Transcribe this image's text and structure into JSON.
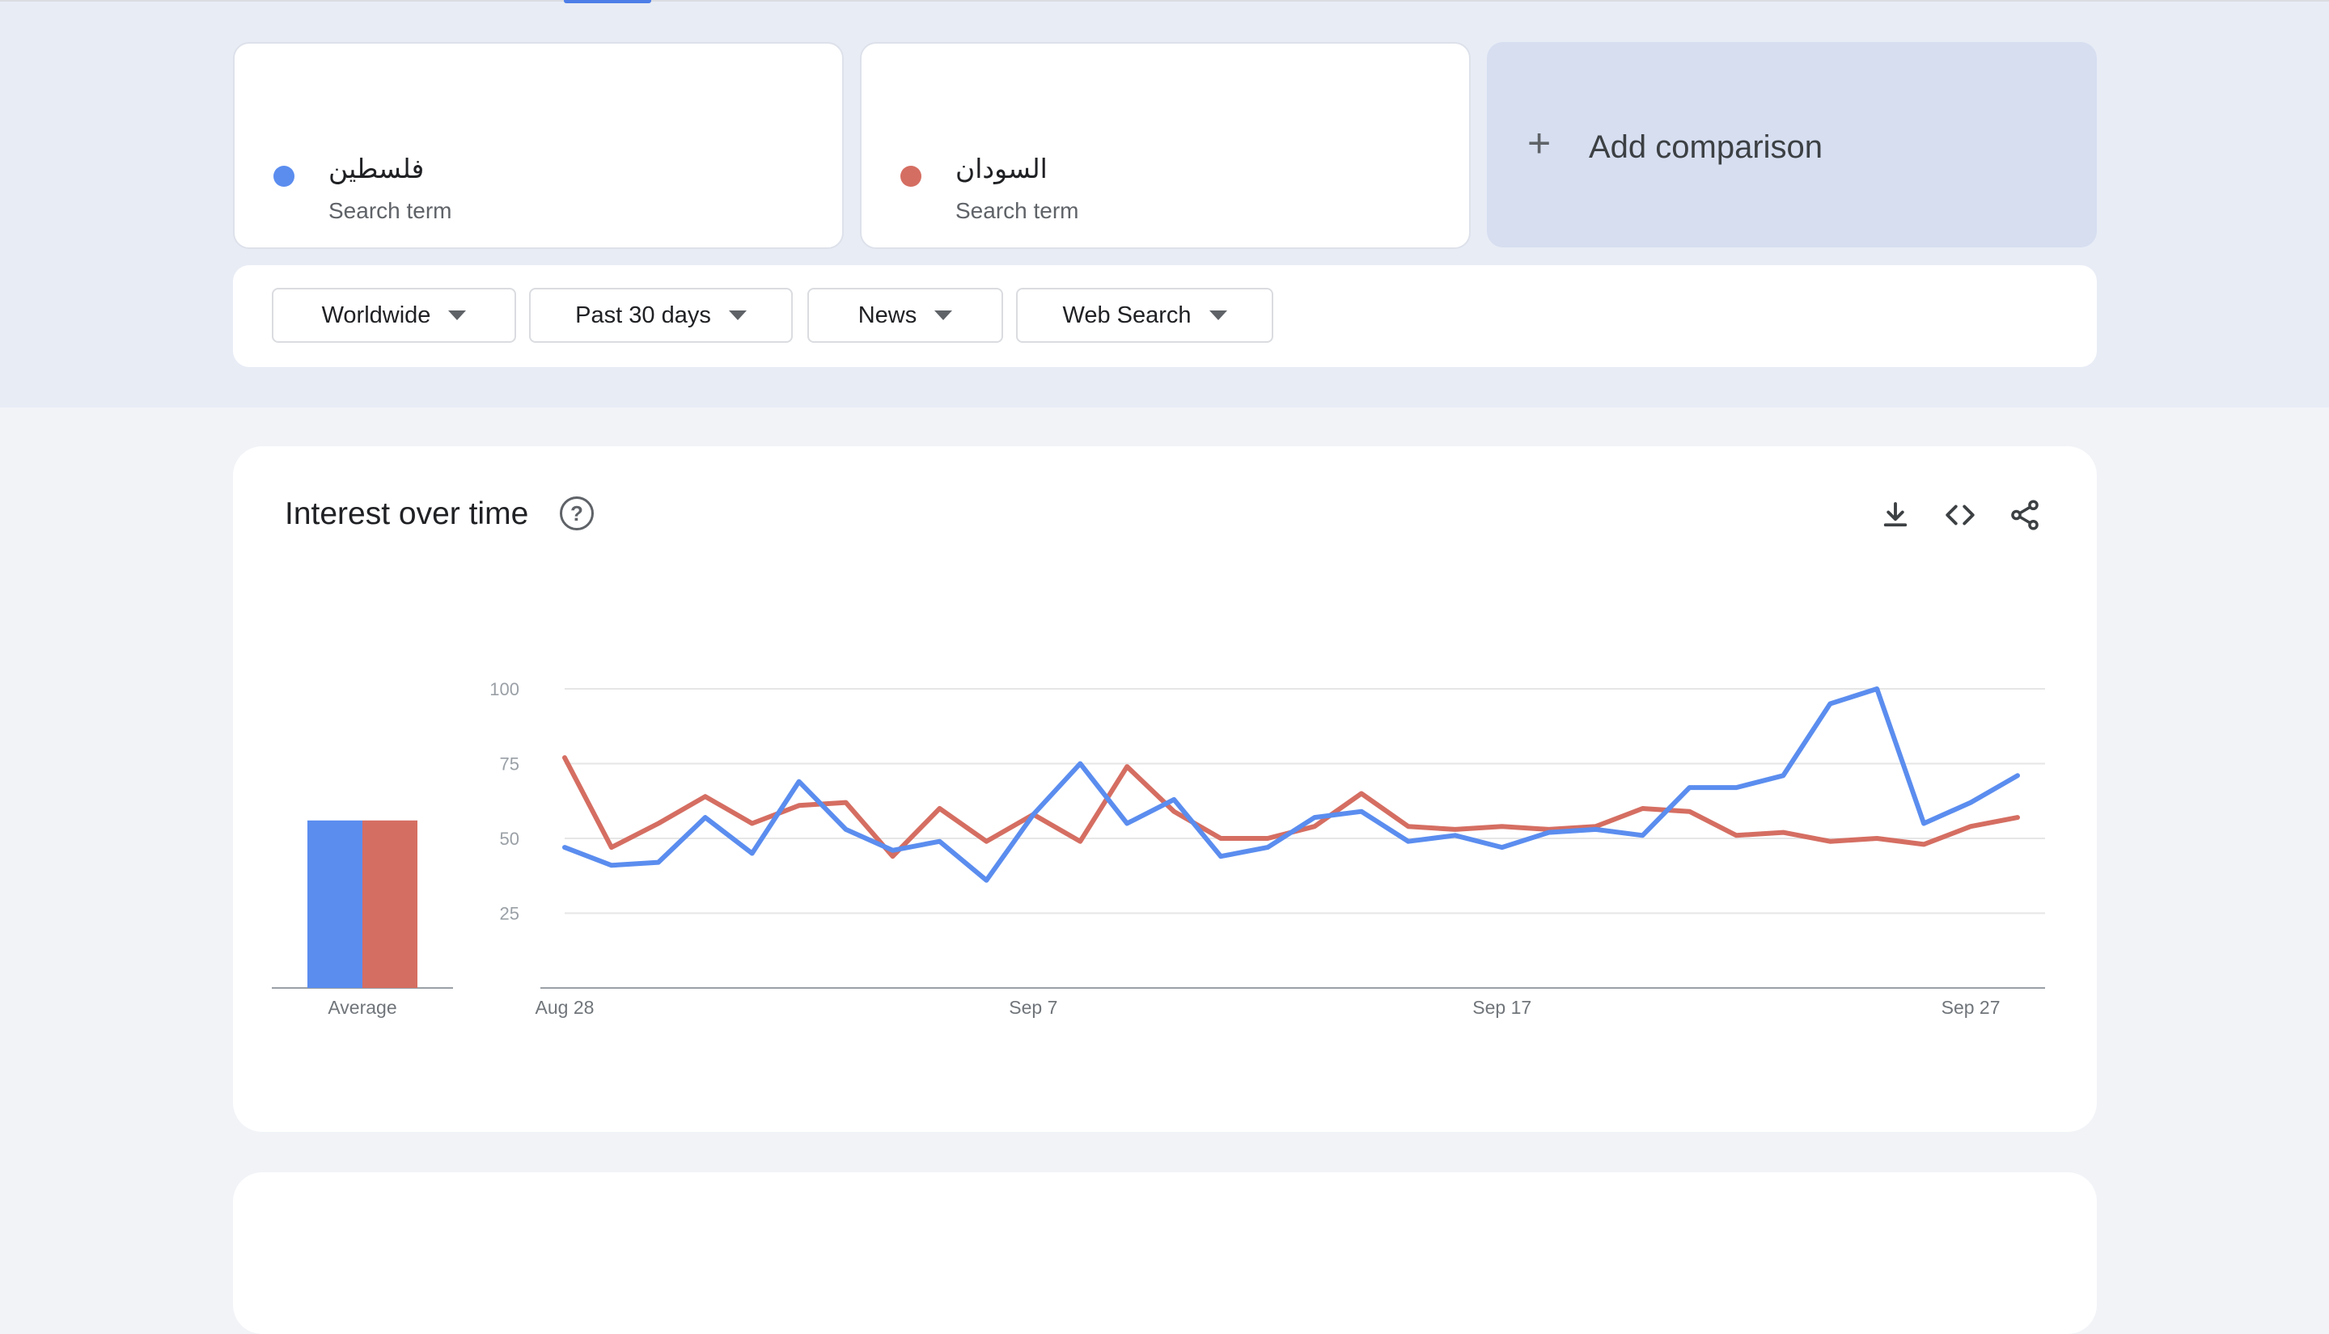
{
  "comparison": {
    "terms": [
      {
        "term": "فلسطين",
        "type": "Search term",
        "color": "#5b8def"
      },
      {
        "term": "السودان",
        "type": "Search term",
        "color": "#d56e62"
      }
    ],
    "add_label": "Add comparison"
  },
  "filters": [
    {
      "label": "Worldwide"
    },
    {
      "label": "Past 30 days"
    },
    {
      "label": "News"
    },
    {
      "label": "Web Search"
    }
  ],
  "panel": {
    "title": "Interest over time",
    "icons": [
      "help-icon",
      "download-icon",
      "embed-icon",
      "share-icon"
    ]
  },
  "chart_data": {
    "type": "line",
    "xlabel": "",
    "ylabel": "",
    "ylim": [
      0,
      100
    ],
    "y_ticks": [
      25,
      50,
      75,
      100
    ],
    "x_tick_labels": [
      {
        "label": "Aug 28",
        "index": 0
      },
      {
        "label": "Sep 7",
        "index": 10
      },
      {
        "label": "Sep 17",
        "index": 20
      },
      {
        "label": "Sep 27",
        "index": 30
      }
    ],
    "average_label": "Average",
    "grid": true,
    "series": [
      {
        "color": "#5b8def",
        "average": 56,
        "values": [
          47,
          41,
          42,
          57,
          45,
          69,
          53,
          46,
          49,
          36,
          58,
          75,
          55,
          63,
          44,
          47,
          57,
          59,
          49,
          51,
          47,
          52,
          53,
          51,
          67,
          67,
          71,
          95,
          100,
          55,
          62,
          71
        ]
      },
      {
        "color": "#d56e62",
        "average": 56,
        "values": [
          77,
          47,
          55,
          64,
          55,
          61,
          62,
          44,
          60,
          49,
          58,
          49,
          74,
          59,
          50,
          50,
          54,
          65,
          54,
          53,
          54,
          53,
          54,
          60,
          59,
          51,
          52,
          49,
          50,
          48,
          54,
          57
        ]
      }
    ]
  }
}
